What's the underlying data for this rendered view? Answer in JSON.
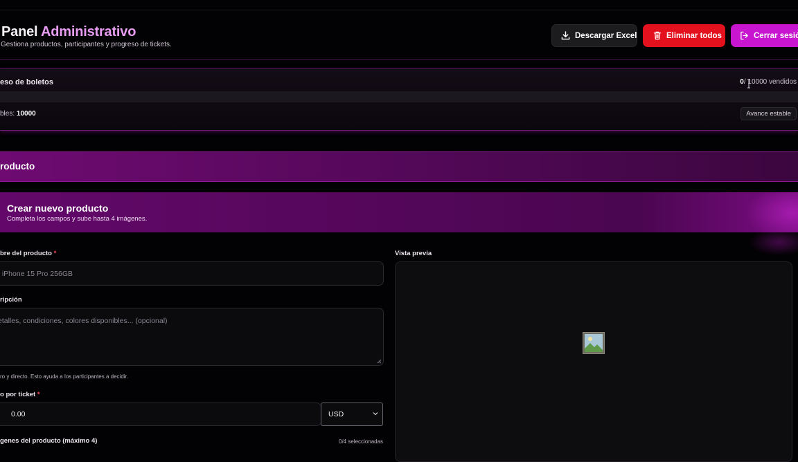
{
  "header": {
    "title_main": "Panel",
    "title_accent": "Administrativo",
    "subtitle": "Gestiona productos, participantes y progreso de tickets.",
    "excel_label": "Descargar Excel",
    "delete_label": "Eliminar todos",
    "logout_label": "Cerrar sesión"
  },
  "progress": {
    "title": "eso de boletos",
    "sold": "0",
    "sold_suffix": "/ 10000 vendidos",
    "available_label": "bles:",
    "available_value": "10000",
    "badge": "Avance estable",
    "percent": 0
  },
  "section": {
    "title": "roducto"
  },
  "create": {
    "title": "Crear nuevo producto",
    "subtitle": "Completa los campos y sube hasta 4 imágenes."
  },
  "form": {
    "name_label": "bre del producto",
    "name_placeholder": ". iPhone 15 Pro 256GB",
    "desc_label": "ripción",
    "desc_placeholder": "etalles, condiciones, colores disponibles... (opcional)",
    "helper": "ro y directo. Esto ayuda a los participantes a decidir.",
    "price_label": "o por ticket",
    "price_value": "0.00",
    "currency": "USD",
    "images_label": "genes del producto (máximo 4)",
    "images_count": "0/4 seleccionadas",
    "required_mark": "*"
  },
  "preview": {
    "label": "Vista previa"
  },
  "colors": {
    "accent": "#e89cf2",
    "danger": "#e2111d",
    "primary": "#c715d0",
    "section": "#6e0a72"
  }
}
